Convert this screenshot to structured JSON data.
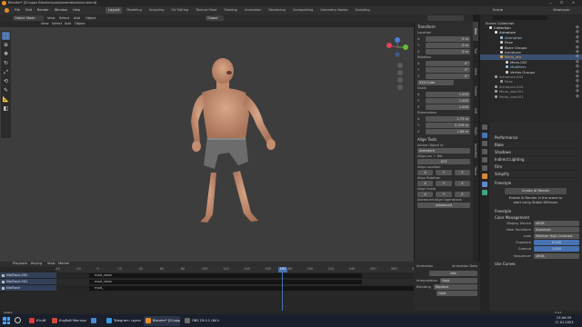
{
  "window_title": "Blender* [D:\\apps Blender\\pool\\assembled\\real.blend]",
  "menu": [
    "File",
    "Edit",
    "Render",
    "Window",
    "Help"
  ],
  "workspace_tabs": [
    "Layout",
    "Modeling",
    "Sculpting",
    "UV Editing",
    "Texture Paint",
    "Shading",
    "Animation",
    "Rendering",
    "Compositing",
    "Geometry Nodes",
    "Scripting"
  ],
  "active_tab": "Layout",
  "header": {
    "mode": "Object Mode",
    "view": "View",
    "select": "Select",
    "add": "Add",
    "object": "Object",
    "orientation": "Global",
    "options": "Options",
    "scene": "Scene",
    "view_layer": "ViewLayer"
  },
  "npanel": {
    "transform_title": "Transform",
    "location_label": "Location",
    "location": [
      "0 m",
      "0 m",
      "0 m"
    ],
    "rotation_label": "Rotation",
    "rotation": [
      "0°",
      "0°",
      "0°"
    ],
    "rotation_mode": "XYZ Euler",
    "scale_label": "Scale",
    "scale": [
      "1.000",
      "1.000",
      "1.000"
    ],
    "dimensions_label": "Dimensions",
    "dimensions": [
      "1.75 m",
      "0.378 m",
      "1.84 m"
    ],
    "align_tools": "Align Tools",
    "active_object": "Active Object is:",
    "armature": "Armature",
    "align_loc_rot": "Align Loc + Rot",
    "align_location": "Align Location",
    "align_rotation": "Align Rotation",
    "align_scale": "Align Scale",
    "advanced": "Advanced Align Operations",
    "advanced_btn": "Advanced",
    "axes": [
      "X",
      "Y",
      "Z"
    ]
  },
  "ntabs": [
    "Item",
    "Tool",
    "View",
    "Create",
    "Edit",
    "Rigify",
    "Animation",
    "Tissue"
  ],
  "outliner": {
    "title": "Scene Collection",
    "items": [
      {
        "label": "Collection",
        "indent": 1,
        "color": "#e0e0e0"
      },
      {
        "label": "Armature",
        "indent": 2,
        "color": "#e0e0e0"
      },
      {
        "label": "Animation",
        "indent": 3,
        "color": "#9bc1e0"
      },
      {
        "label": "Pose",
        "indent": 3,
        "color": "#d0d0d0"
      },
      {
        "label": "Bone Groups",
        "indent": 3,
        "color": "#d0d0d0"
      },
      {
        "label": "Armature",
        "indent": 3,
        "color": "#d0d0d0"
      },
      {
        "label": "Mens_low",
        "indent": 3,
        "color": "#e9a44c"
      },
      {
        "label": "Mens.003",
        "indent": 4,
        "color": "#d0d0d0"
      },
      {
        "label": "Modifiers",
        "indent": 4,
        "color": "#9bc1e0"
      },
      {
        "label": "Vertex Groups",
        "indent": 4,
        "color": "#d0d0d0"
      },
      {
        "label": "Armature.002",
        "indent": 2,
        "color": "#9a9a9a"
      },
      {
        "label": "Pose",
        "indent": 3,
        "color": "#9a9a9a"
      },
      {
        "label": "Armature.003",
        "indent": 2,
        "color": "#9a9a9a"
      },
      {
        "label": "Mens_low.001",
        "indent": 2,
        "color": "#9a9a9a"
      },
      {
        "label": "Pants_low.001",
        "indent": 2,
        "color": "#9a9a9a"
      }
    ]
  },
  "props": {
    "sections": [
      "Performance",
      "Bake",
      "Shadows",
      "Indirect Lighting",
      "Film",
      "Simplify"
    ],
    "freestyle_title": "Freestyle",
    "render_btn": "Create AI Render",
    "enable_text": "Enable AI Render in the scene to",
    "start_text": "start using Stable Diffusion",
    "freestyle2": "Freestyle",
    "color_mgmt": "Color Management",
    "display_device_label": "Display Device",
    "display_device": "sRGB",
    "view_transform_label": "View Transform",
    "view_transform": "Standard",
    "look_label": "Look",
    "look": "Medium High Contrast",
    "exposure_label": "Exposure",
    "exposure": "0.000",
    "gamma_label": "Gamma",
    "gamma": "1.000",
    "sequencer_label": "Sequencer",
    "sequencer": "sRGB",
    "use_curves": "Use Curves"
  },
  "timeline": {
    "menu": [
      "Playback",
      "Keying",
      "View",
      "Marker"
    ],
    "ticks": [
      "-40",
      "-20",
      "0",
      "20",
      "40",
      "60",
      "80",
      "100",
      "120",
      "140",
      "160",
      "180",
      "200",
      "220",
      "240",
      "260",
      "280",
      "300"
    ],
    "current_frame": "162",
    "current_frame_pos": 0.63,
    "tracks": [
      {
        "name": "NlaTrack.002",
        "strip": "mpd_skew"
      },
      {
        "name": "NlaTrack.001",
        "strip": "mpd_skew"
      },
      {
        "name": "NlaTrack",
        "strip": "mpd_"
      }
    ],
    "right_panel": {
      "animation_label": "Animation",
      "anim_data": "Animation Data",
      "action": "Idle",
      "interpolation_label": "Interpolation",
      "interpolation": "Hold",
      "blending_label": "Blending",
      "blending": "Replace",
      "hold": "Hold"
    }
  },
  "status": {
    "mouse": "Select",
    "version": "3.4.1"
  },
  "taskbar": {
    "items": [
      {
        "label": "Ютуб",
        "color": "#e03a3a"
      },
      {
        "label": "Клубой Мастерн | ...",
        "color": "#d04a3a"
      },
      {
        "label": "",
        "color": "#4a8ad0"
      },
      {
        "label": "Telegram: группа ...",
        "color": "#3a9ae0"
      },
      {
        "label": "Blender* [D:\\apps\\...",
        "color": "#e58b2c"
      },
      {
        "label": "OBS 29.0.1 (64 bit...",
        "color": "#6a6a6a"
      }
    ],
    "time": "23:06:59",
    "date": "17.01.2023"
  }
}
